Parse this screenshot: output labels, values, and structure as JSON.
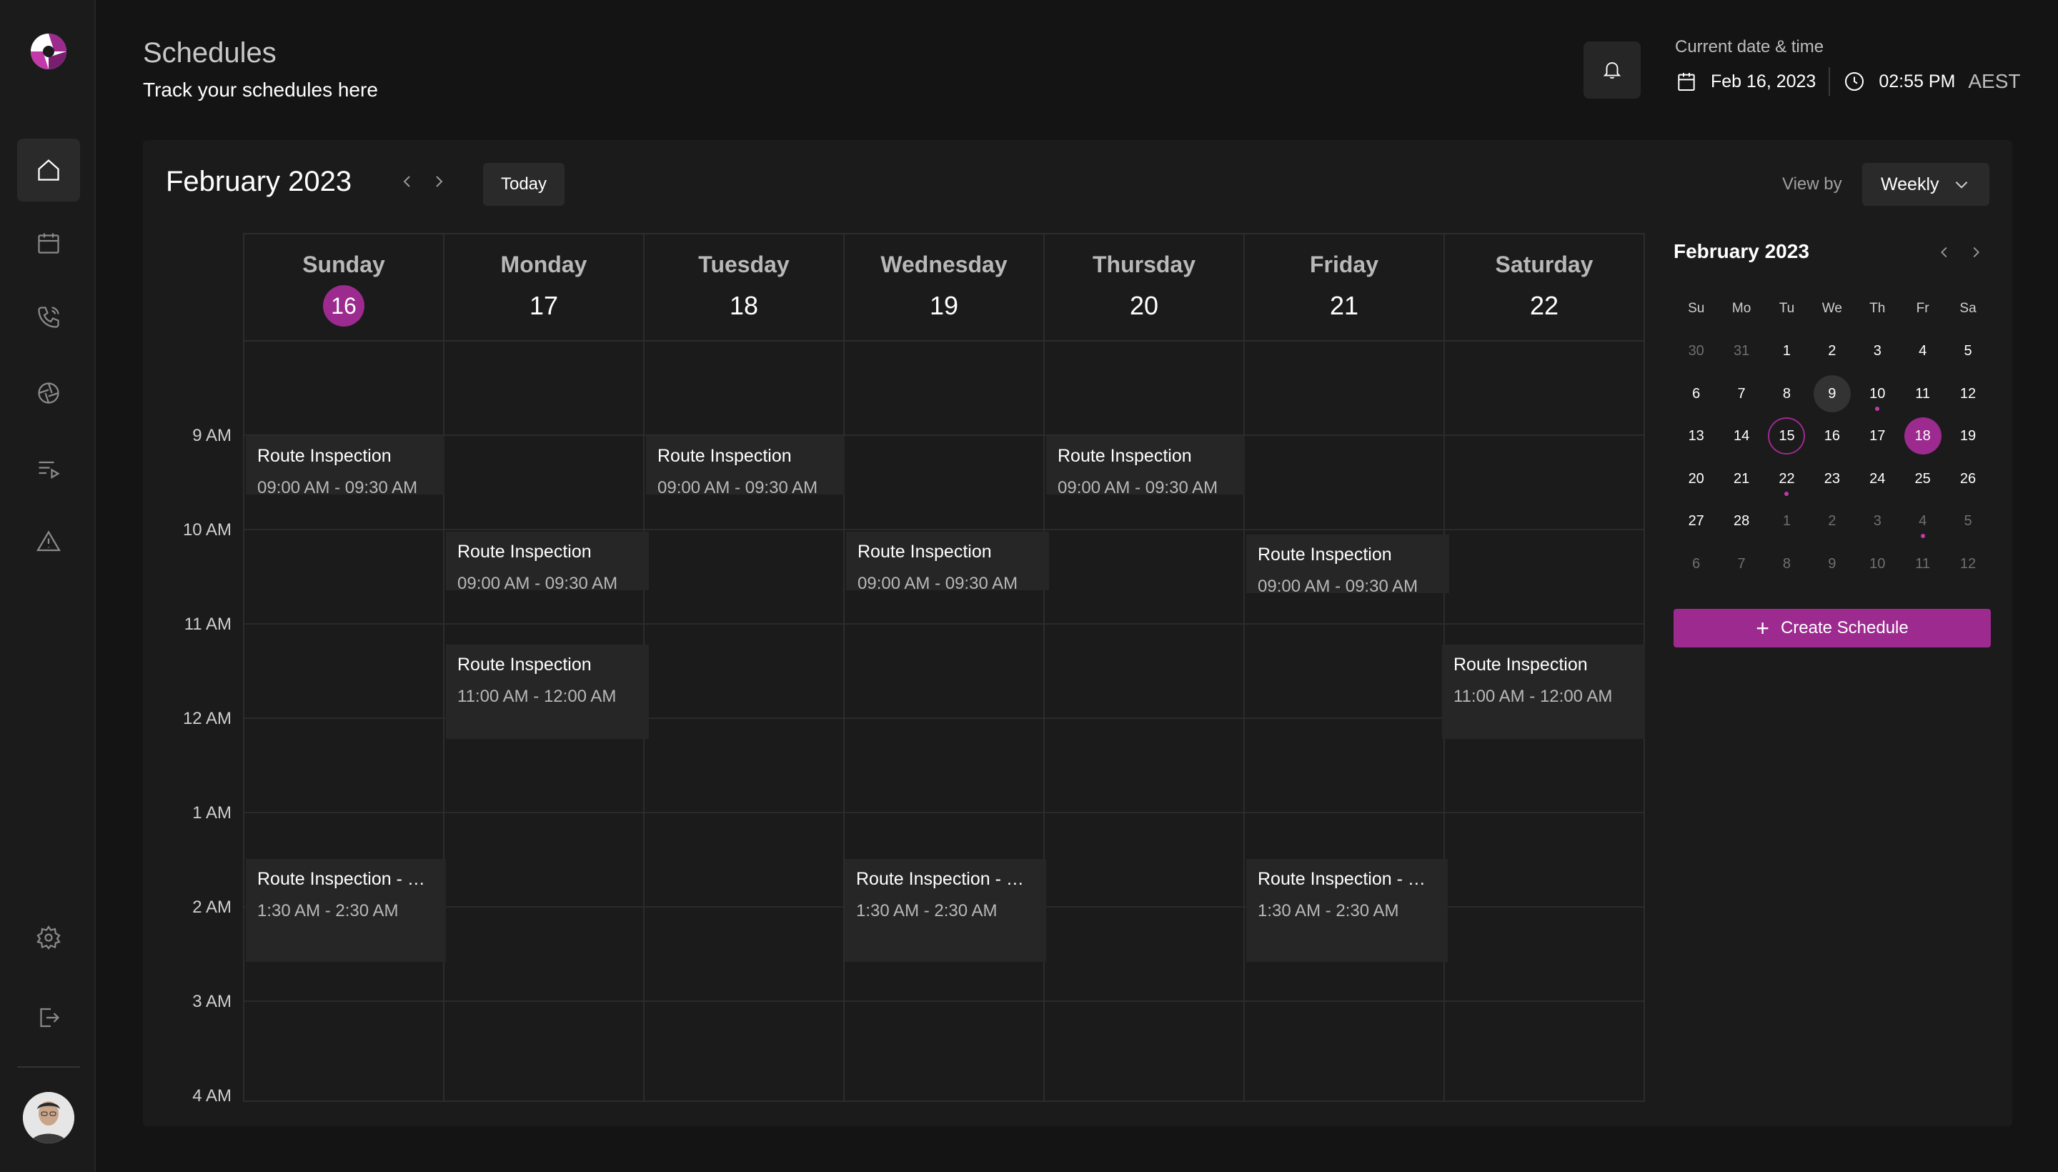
{
  "header": {
    "title": "Schedules",
    "subtitle": "Track your schedules here",
    "datetime_label": "Current date & time",
    "date": "Feb 16, 2023",
    "time": "02:55 PM",
    "timezone": "AEST"
  },
  "sidebar": {
    "items": [
      {
        "icon": "home-icon",
        "active": true
      },
      {
        "icon": "calendar-icon",
        "active": false
      },
      {
        "icon": "phone-icon",
        "active": false
      },
      {
        "icon": "aperture-icon",
        "active": false
      },
      {
        "icon": "playlist-icon",
        "active": false
      },
      {
        "icon": "warning-icon",
        "active": false
      }
    ],
    "bottom": [
      {
        "icon": "settings-icon"
      },
      {
        "icon": "logout-icon"
      }
    ]
  },
  "calendar": {
    "month_title": "February 2023",
    "today_label": "Today",
    "viewby_label": "View by",
    "viewby_value": "Weekly",
    "days": [
      {
        "name": "Sunday",
        "num": "16",
        "today": true
      },
      {
        "name": "Monday",
        "num": "17",
        "today": false
      },
      {
        "name": "Tuesday",
        "num": "18",
        "today": false
      },
      {
        "name": "Wednesday",
        "num": "19",
        "today": false
      },
      {
        "name": "Thursday",
        "num": "20",
        "today": false
      },
      {
        "name": "Friday",
        "num": "21",
        "today": false
      },
      {
        "name": "Saturday",
        "num": "22",
        "today": false
      }
    ],
    "time_labels": [
      "9 AM",
      "10 AM",
      "11 AM",
      "12 AM",
      "1 AM",
      "2 AM",
      "3 AM",
      "4 AM"
    ],
    "events": [
      {
        "title": "Route Inspection",
        "time": "09:00 AM - 09:30 AM"
      },
      {
        "title": "Route Inspection",
        "time": "09:00 AM - 09:30 AM"
      },
      {
        "title": "Route Inspection",
        "time": "09:00 AM - 09:30 AM"
      },
      {
        "title": "Route Inspection",
        "time": "09:00 AM - 09:30 AM"
      },
      {
        "title": "Route Inspection",
        "time": "09:00 AM - 09:30 AM"
      },
      {
        "title": "Route Inspection",
        "time": "09:00 AM - 09:30 AM"
      },
      {
        "title": "Route Inspection",
        "time": "11:00 AM - 12:00 AM"
      },
      {
        "title": "Route Inspection",
        "time": "11:00 AM - 12:00 AM"
      },
      {
        "title": "Route Inspection - M...",
        "time": "1:30 AM - 2:30 AM"
      },
      {
        "title": "Route Inspection - M...",
        "time": "1:30 AM - 2:30 AM"
      },
      {
        "title": "Route Inspection - M...",
        "time": "1:30 AM - 2:30 AM"
      }
    ]
  },
  "mini_calendar": {
    "title": "February 2023",
    "weekdays": [
      "Su",
      "Mo",
      "Tu",
      "We",
      "Th",
      "Fr",
      "Sa"
    ],
    "weeks": [
      [
        "30",
        "31",
        "1",
        "2",
        "3",
        "4",
        "5"
      ],
      [
        "6",
        "7",
        "8",
        "9",
        "10",
        "11",
        "12"
      ],
      [
        "13",
        "14",
        "15",
        "16",
        "17",
        "18",
        "19"
      ],
      [
        "20",
        "21",
        "22",
        "23",
        "24",
        "25",
        "26"
      ],
      [
        "27",
        "28",
        "1",
        "2",
        "3",
        "4",
        "5"
      ],
      [
        "6",
        "7",
        "8",
        "9",
        "10",
        "11",
        "12"
      ]
    ]
  },
  "create_button": "Create Schedule",
  "colors": {
    "accent": "#9c2a8f",
    "background": "#141414",
    "panel": "#1b1b1b",
    "event": "#262626"
  }
}
